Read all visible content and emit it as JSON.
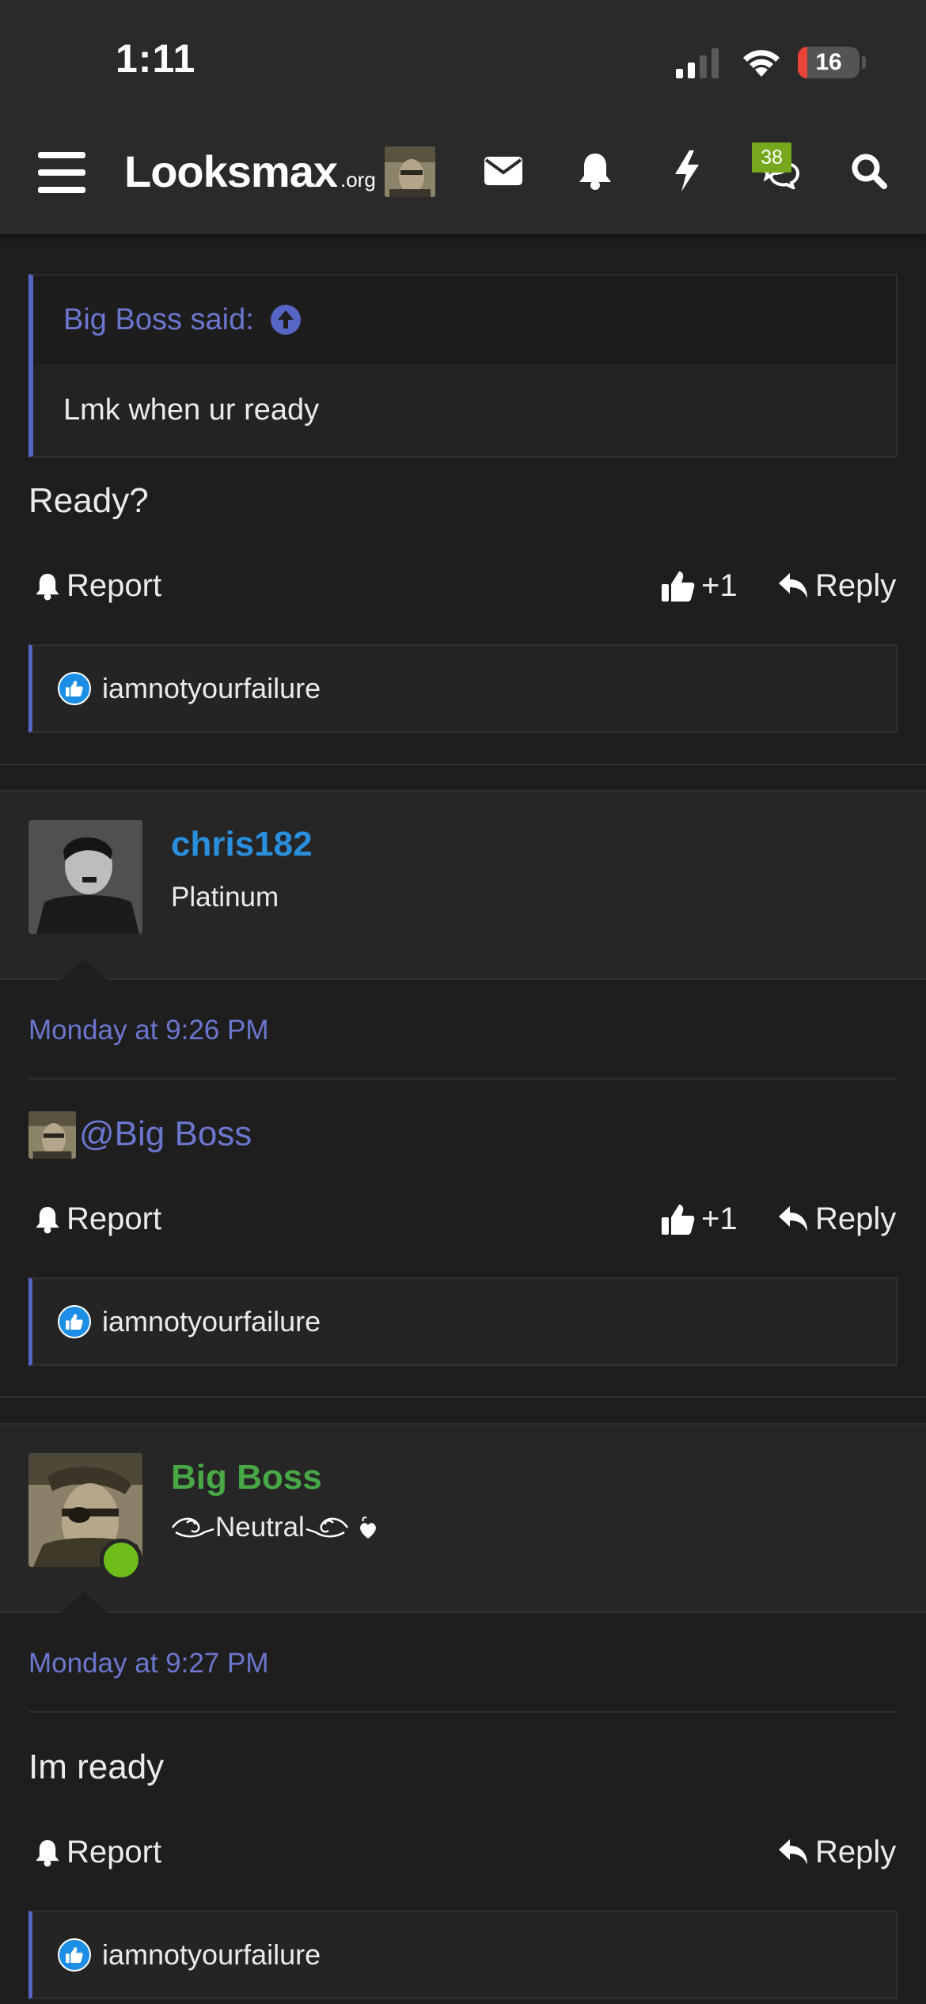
{
  "status_bar": {
    "time": "1:11",
    "battery": "16"
  },
  "header": {
    "logo_main": "Looksmax",
    "logo_tld": ".org",
    "conversations_badge": "38",
    "icons": [
      "menu-icon",
      "avatar",
      "envelope-icon",
      "bell-icon",
      "bolt-icon",
      "chat-bubbles-icon",
      "search-icon"
    ]
  },
  "post1": {
    "quote_author": "Big Boss said:",
    "quote_text": "Lmk when ur ready",
    "text": "Ready?",
    "report_label": "Report",
    "like_count": "+1",
    "reply_label": "Reply",
    "reaction_user": "iamnotyourfailure"
  },
  "post2": {
    "username": "chris182",
    "user_title": "Platinum",
    "username_color": "#2a8fdc",
    "date": "Monday at 9:26 PM",
    "mention": "@Big Boss",
    "report_label": "Report",
    "like_count": "+1",
    "reply_label": "Reply",
    "reaction_user": "iamnotyourfailure"
  },
  "post3": {
    "username": "Big Boss",
    "user_title": "Neutral",
    "username_color": "#49a846",
    "date": "Monday at 9:27 PM",
    "text": "Im ready",
    "report_label": "Report",
    "reply_label": "Reply",
    "reaction_user": "iamnotyourfailure"
  },
  "colors": {
    "accent": "#5765c4",
    "link": "#6b77cf",
    "online": "#6dbc1a",
    "badge": "#76a81d"
  }
}
